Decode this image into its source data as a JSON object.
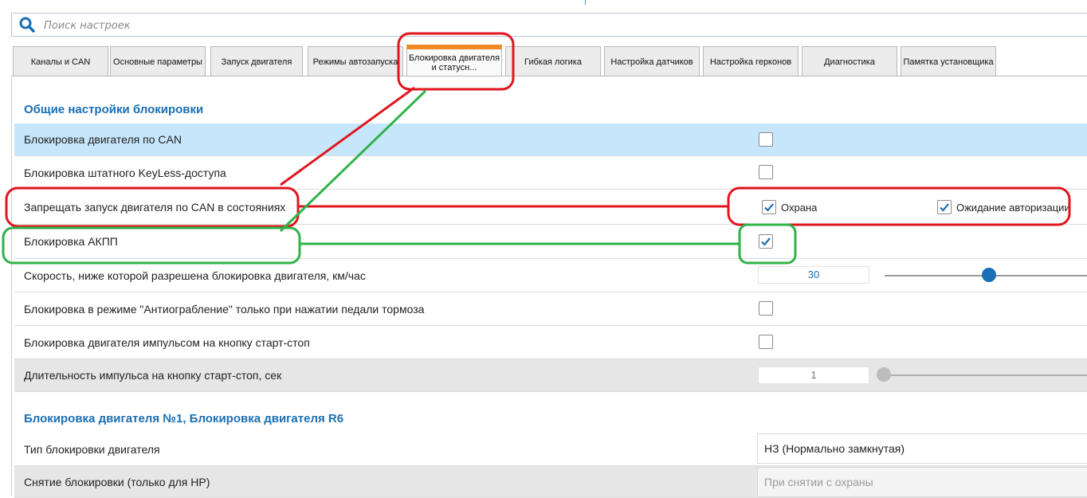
{
  "search": {
    "placeholder": "Поиск настроек"
  },
  "tabs": [
    {
      "label": "Каналы и CAN"
    },
    {
      "label": "Основные параметры"
    },
    {
      "label": "Запуск двигателя"
    },
    {
      "label": "Режимы автозапуска"
    },
    {
      "label": "Блокировка двигателя и статусн..."
    },
    {
      "label": "Гибкая логика"
    },
    {
      "label": "Настройка датчиков"
    },
    {
      "label": "Настройка герконов"
    },
    {
      "label": "Диагностика"
    },
    {
      "label": "Памятка установщика"
    }
  ],
  "sections": {
    "general": {
      "title": "Общие настройки блокировки"
    },
    "block1": {
      "title": "Блокировка двигателя №1, Блокировка двигателя R6"
    }
  },
  "rows": {
    "can_block": {
      "label": "Блокировка двигателя по CAN",
      "checked": false
    },
    "keyless": {
      "label": "Блокировка штатного KeyLess-доступа",
      "checked": false
    },
    "forbid_start": {
      "label": "Запрещать запуск двигателя по CAN в состояниях",
      "option1": {
        "label": "Охрана",
        "checked": true
      },
      "option2": {
        "label": "Ожидание авторизации",
        "checked": true
      }
    },
    "akpp": {
      "label": "Блокировка АКПП",
      "checked": true
    },
    "speed": {
      "label": "Скорость, ниже которой разрешена блокировка двигателя, км/час",
      "value": "30"
    },
    "antirobbery": {
      "label": "Блокировка в режиме \"Антиограбление\" только при нажатии педали тормоза",
      "checked": false
    },
    "impulse_block": {
      "label": "Блокировка двигателя импульсом на кнопку старт-стоп",
      "checked": false
    },
    "impulse_len": {
      "label": "Длительность импульса на кнопку старт-стоп, сек",
      "value": "1"
    },
    "block_type": {
      "label": "Тип блокировки двигателя",
      "value": "НЗ (Нормально замкнутая)"
    },
    "unblock": {
      "label": "Снятие блокировки (только для НР)",
      "value": "При снятии с охраны"
    }
  },
  "colors": {
    "accent": "#1a6fb5",
    "active_tab": "#f08a24",
    "highlight_row": "#c6e6fb",
    "annotation_red": "#e0161e",
    "annotation_green": "#2fb34a"
  }
}
